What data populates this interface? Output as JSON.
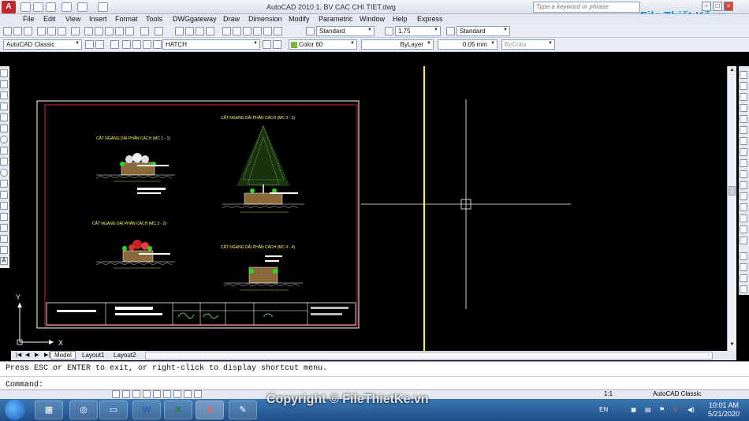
{
  "window": {
    "title": "AutoCAD 2010    1. BV CAC CHI TIET.dwg",
    "search_placeholder": "Type a keyword or phrase",
    "brand": "File Thiết Kế.vn"
  },
  "menu": [
    "File",
    "Edit",
    "View",
    "Insert",
    "Format",
    "Tools",
    "DWGgateway",
    "Draw",
    "Dimension",
    "Modify",
    "Parametric",
    "Window",
    "Help",
    "Express"
  ],
  "toolbar": {
    "text_style": "Standard",
    "dim_scale": "1.75",
    "dim_style": "Standard",
    "workspace": "AutoCAD Classic",
    "layer": "HATCH",
    "color": "Color 60",
    "linetype": "ByLayer",
    "lineweight": "0.05 mm",
    "plotstyle": "ByColor"
  },
  "drawing": {
    "sections": [
      "CẮT NGANG DẢI PHÂN CÁCH (MC 1 - 1)",
      "CẮT NGANG DẢI PHÂN CÁCH (MC 3 - 3)",
      "CẮT NGANG DẢI PHÂN CÁCH (MC 2 - 2)",
      "CẮT NGANG DẢI PHÂN CÁCH (MC 4 - 4)"
    ],
    "axis_x": "X",
    "axis_y": "Y"
  },
  "tabs": [
    "Model",
    "Layout1",
    "Layout2"
  ],
  "command": {
    "message": "Press ESC or ENTER to exit, or right-click to display shortcut menu.",
    "prompt": "Command:"
  },
  "status": {
    "scale": "1:1",
    "workspace": "AutoCAD Classic"
  },
  "taskbar": {
    "lang": "EN",
    "time": "10:01 AM",
    "date": "5/21/2020",
    "copyright": "Copyright © FileThietKe.vn"
  },
  "colors": {
    "accent_yellow": "#ffff00",
    "frame_red": "#d0203a",
    "autocad_red": "#c0282d"
  }
}
